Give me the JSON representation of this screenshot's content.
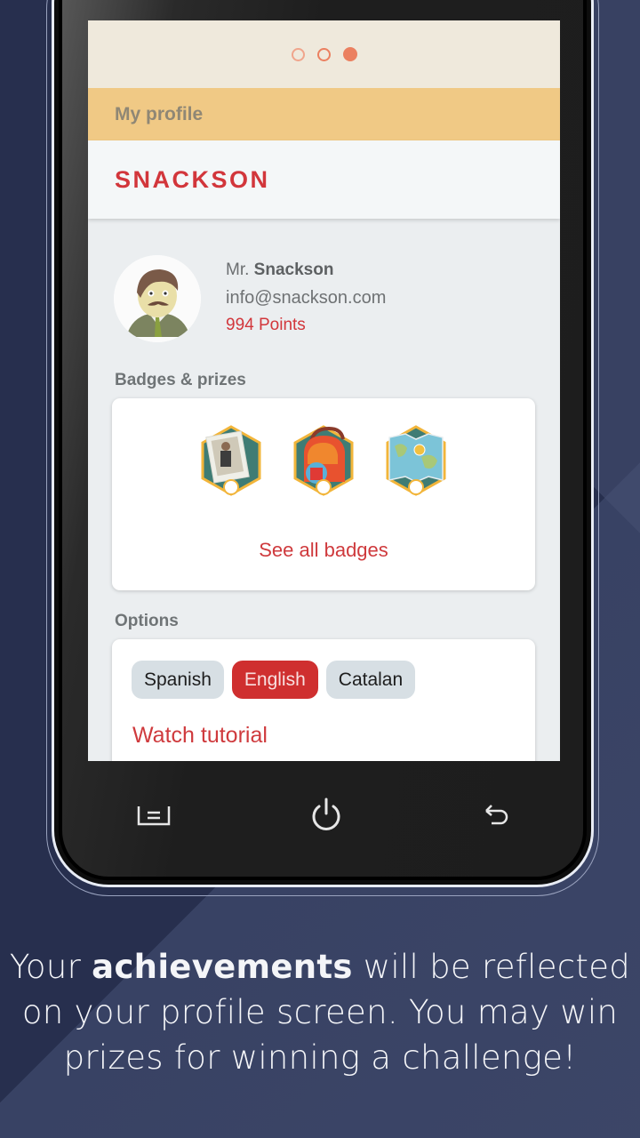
{
  "pager": {
    "page_count": 3,
    "active_index": 2
  },
  "app": {
    "title": "My profile",
    "brand": "SNACKSON"
  },
  "profile": {
    "name_prefix": "Mr.",
    "name": "Snackson",
    "email": "info@snackson.com",
    "points": "994 Points",
    "avatar": "mr-snackson-avatar"
  },
  "badges": {
    "label": "Badges & prizes",
    "items": [
      {
        "name": "stamp-badge"
      },
      {
        "name": "backpack-badge"
      },
      {
        "name": "map-badge"
      }
    ],
    "see_all": "See all badges"
  },
  "options": {
    "label": "Options",
    "languages": [
      {
        "label": "Spanish",
        "selected": false
      },
      {
        "label": "English",
        "selected": true
      },
      {
        "label": "Catalan",
        "selected": false
      }
    ],
    "tutorial": "Watch tutorial"
  },
  "navbar": {
    "buttons": [
      {
        "icon": "menu-icon"
      },
      {
        "icon": "power-icon"
      },
      {
        "icon": "back-icon"
      }
    ]
  },
  "caption": {
    "before": "Your ",
    "bold": "achievements",
    "after": " will be reflected on your profile screen. You may win prizes for winning a challenge!"
  },
  "colors": {
    "background": "#272f4e",
    "accent_red": "#d2363b",
    "appbar": "#f0c985",
    "pager_dot": "#eb8060"
  }
}
